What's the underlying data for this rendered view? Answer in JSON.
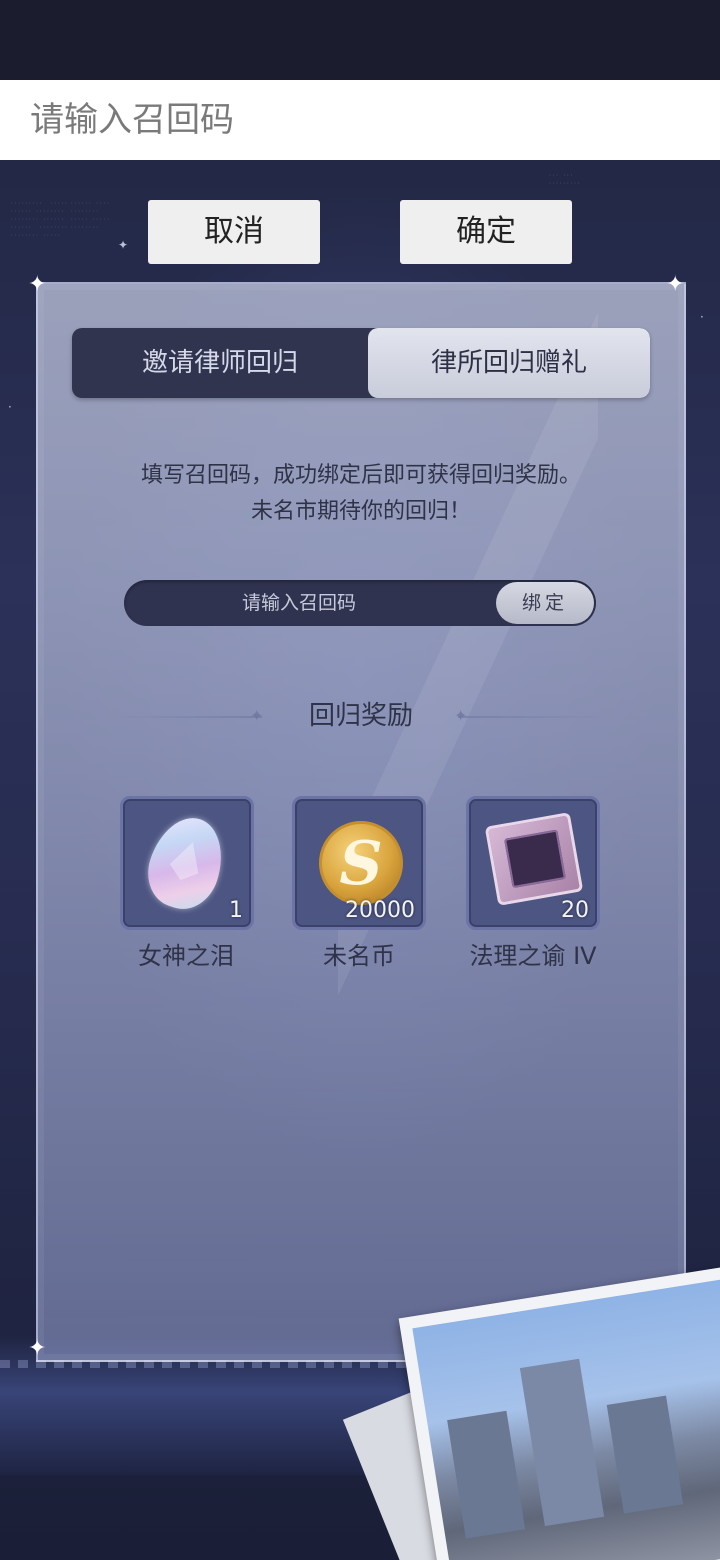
{
  "input_bar": {
    "placeholder": "请输入召回码"
  },
  "dialog": {
    "cancel_label": "取消",
    "confirm_label": "确定"
  },
  "tabs": [
    {
      "label": "邀请律师回归",
      "active": false
    },
    {
      "label": "律所回归赠礼",
      "active": true
    }
  ],
  "description": {
    "line1": "填写召回码，成功绑定后即可获得回归奖励。",
    "line2": "未名市期待你的回归！"
  },
  "bind": {
    "placeholder": "请输入召回码",
    "button_label": "绑定"
  },
  "rewards": {
    "title": "回归奖励",
    "items": [
      {
        "name": "女神之泪",
        "quantity": "1",
        "icon": "gem-icon"
      },
      {
        "name": "未名币",
        "quantity": "20000",
        "icon": "coin-icon"
      },
      {
        "name": "法理之谕 IV",
        "quantity": "20",
        "icon": "chip-icon"
      }
    ]
  },
  "coin_glyph": "S",
  "colors": {
    "panel": "#c8cee6",
    "tab_dark": "#30344f",
    "bind_field": "#2f3350",
    "item_box": "#4d5683"
  }
}
